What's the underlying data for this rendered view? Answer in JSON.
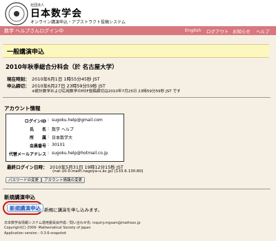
{
  "header": {
    "org_sub": "社団法人",
    "org_name": "日本数学会",
    "tagline": "オンライン講演申込・アブストラクト投稿システム"
  },
  "navbar": {
    "user_label": "数学 ヘルプさんログイン中",
    "links": [
      "English",
      "ログアウト",
      "お知らせ",
      "ヘルプ"
    ]
  },
  "page_title": "一般講演申込",
  "conference": "2010年秋季総合分科会（於 名古屋大学）",
  "dates": {
    "now_label": "現在時刻：",
    "now_value": "2010年6月1日 1時55分45秒 JST",
    "deadline_label": "申込締切：",
    "deadline_value": "2010年6月27日 23時59分59秒 JST",
    "deadline_note": "※統計数学および応用数学のPDF投稿締切は2010年7月25日 23時59分59秒 JST です"
  },
  "account": {
    "section_title": "アカウント情報",
    "rows": [
      {
        "label": "ログインID",
        "value": "sugoku.help@gmail.com"
      },
      {
        "label": "氏　　名",
        "value": "数学 ヘルプ"
      },
      {
        "label": "所　　属",
        "value": "日本数学大"
      },
      {
        "label": "会員番号",
        "value": "30101"
      },
      {
        "label": "代替メールアドレス",
        "value": "sugoku.help@hotmail.co.jp"
      }
    ],
    "last_login_label": "最終ログイン日時：",
    "last_login_value": "2010年5月31日 19時12分15秒 JST",
    "last_login_host": "(nat-10-0.math.nagoya-u.ac.jp) [133.6.130.80]",
    "change_password": "パスワードの変更",
    "change_account": "アカウント情報の変更"
  },
  "new_lecture": {
    "section_title": "新規講演申込",
    "button": "新規講演申込",
    "description": "新規に講演を申し込みます。"
  },
  "footer": {
    "line1": "日本数学会情報システム運用委員会作成／問い合わせ先: inquiry.mgsam@mathsoc.jp",
    "line2": "Copyright(C) 2009- Mathematical Society of Japan",
    "line3": "Application version : 0.3.6-snapshot"
  },
  "colors": {
    "navbar": "#d8787e",
    "title_bg": "#fbf7bf",
    "page_bg": "#f6f0e4",
    "highlight": "#d01010"
  }
}
